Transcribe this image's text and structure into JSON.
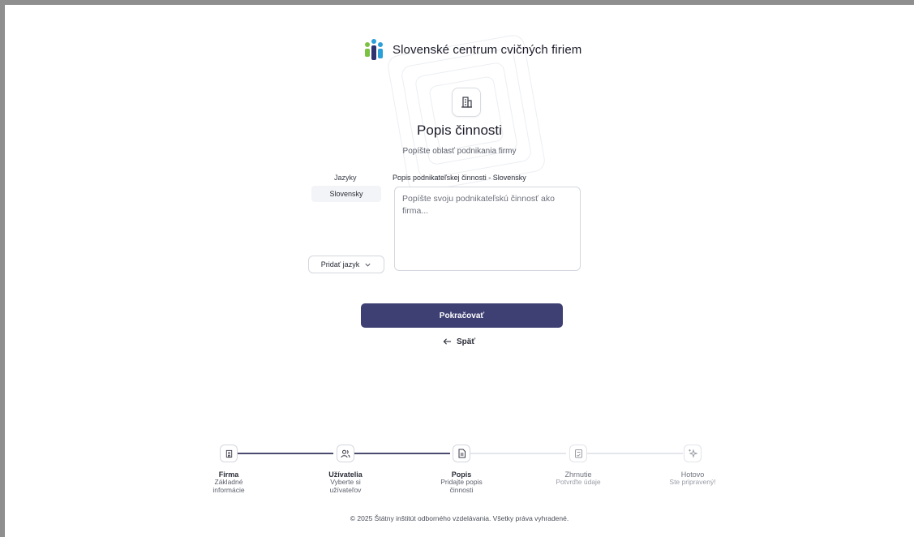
{
  "brand": {
    "name": "Slovenské centrum cvičných firiem"
  },
  "page": {
    "title": "Popis činnosti",
    "subtitle": "Popíšte oblasť podnikania firmy",
    "header_icon": "building-icon"
  },
  "form": {
    "languages_label": "Jazyky",
    "description_label": "Popis podnikateľskej činnosti - Slovensky",
    "selected_language": "Slovensky",
    "description_value": "",
    "description_placeholder": "Popíšte svoju podnikateľskú činnosť ako firma...",
    "add_language_label": "Pridať jazyk"
  },
  "actions": {
    "continue_label": "Pokračovať",
    "back_label": "Späť"
  },
  "stepper": {
    "active_color": "#4a4b6e",
    "inactive_color": "#e4e6eb",
    "steps": [
      {
        "name": "Firma",
        "desc": "Základné informácie",
        "icon": "building-icon",
        "state": "done"
      },
      {
        "name": "Užívatelia",
        "desc": "Vyberte si užívateľov",
        "icon": "users-icon",
        "state": "done"
      },
      {
        "name": "Popis",
        "desc": "Pridajte popis činnosti",
        "icon": "document-icon",
        "state": "current"
      },
      {
        "name": "Zhrnutie",
        "desc": "Potvrďte údaje",
        "icon": "checklist-icon",
        "state": "upcoming"
      },
      {
        "name": "Hotovo",
        "desc": "Ste pripravený!",
        "icon": "sparkles-icon",
        "state": "upcoming"
      }
    ]
  },
  "footer": {
    "text": "© 2025 Štátny inštitút odborného vzdelávania. Všetky práva vyhradené."
  },
  "colors": {
    "primary": "#3e3f73",
    "logo_green": "#7cc242",
    "logo_blue": "#2a9fd8",
    "logo_navy": "#2d3270"
  }
}
